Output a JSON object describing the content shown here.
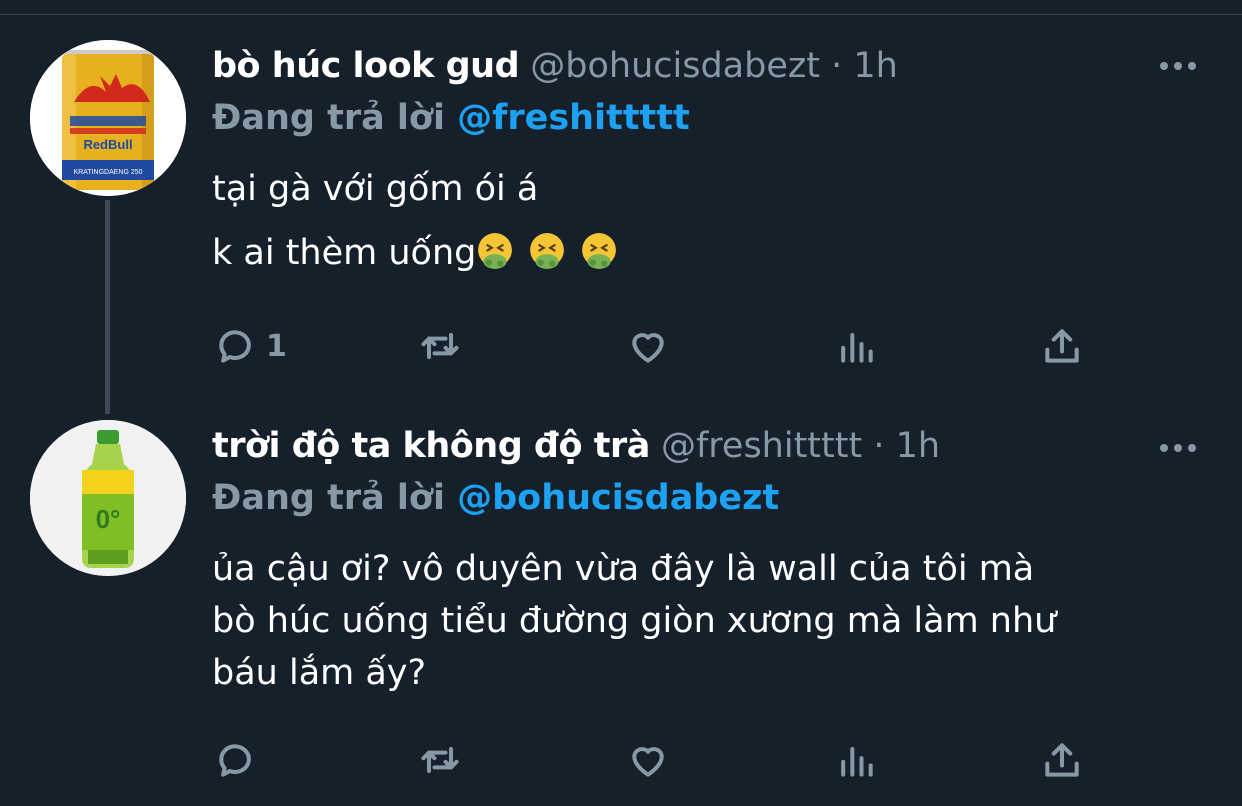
{
  "tweets": [
    {
      "display_name": "bò húc look gud",
      "handle": "@bohucisdabezt",
      "separator": "·",
      "time": "1h",
      "reply_prefix": "Đang trả lời",
      "reply_handle": "@freshittttt",
      "body_lines": [
        "tại gà với gốm ói á",
        "k ai thèm uống"
      ],
      "emojis": [
        "nauseated-face-icon",
        "nauseated-face-icon",
        "nauseated-face-icon"
      ],
      "avatar": {
        "product": "red-bull-can",
        "label_top": "RedBull",
        "label_bottom": "KRATINGDAENG 250",
        "colors": {
          "gold": "#e7b01f",
          "blue": "#1f4aa0",
          "red": "#d12a1d"
        }
      },
      "actions": {
        "reply_count": "1"
      }
    },
    {
      "display_name": "trời độ ta không độ trà",
      "handle": "@freshittttt",
      "separator": "·",
      "time": "1h",
      "reply_prefix": "Đang trả lời",
      "reply_handle": "@bohucisdabezt",
      "body_lines": [
        "ủa cậu ơi? vô duyên vừa đây là wall của tôi mà",
        "bò húc uống tiểu đường giòn xương mà làm như",
        "báu lắm ấy?"
      ],
      "avatar": {
        "product": "green-tea-bottle",
        "label_mark": "0°",
        "colors": {
          "green": "#7fbf25",
          "yellow": "#f4d21b",
          "cap": "#3a9b2e"
        }
      },
      "actions": {
        "reply_count": ""
      }
    }
  ],
  "colors": {
    "background": "#15202b",
    "text_primary": "#ffffff",
    "text_secondary": "#8899a6",
    "link": "#1da1f2",
    "thread_line": "#3d4a55"
  }
}
